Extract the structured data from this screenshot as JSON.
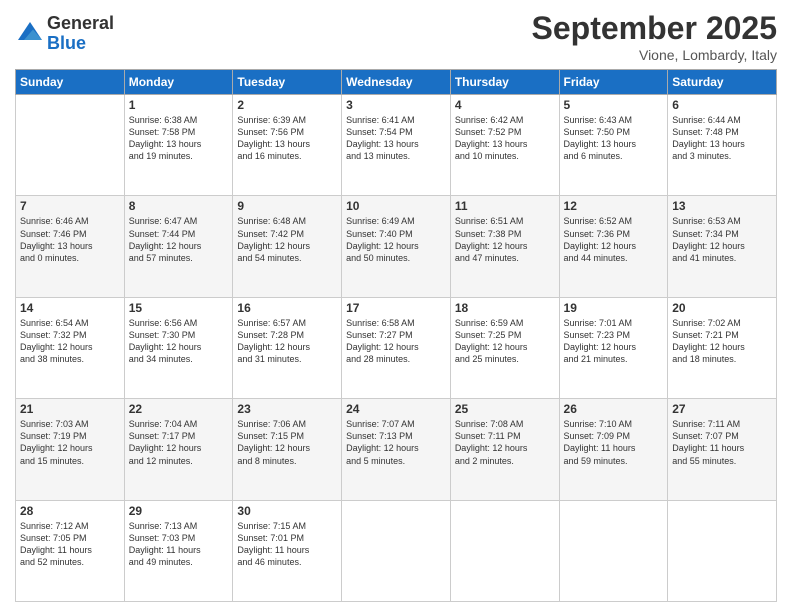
{
  "header": {
    "logo_general": "General",
    "logo_blue": "Blue",
    "month_title": "September 2025",
    "location": "Vione, Lombardy, Italy"
  },
  "days_of_week": [
    "Sunday",
    "Monday",
    "Tuesday",
    "Wednesday",
    "Thursday",
    "Friday",
    "Saturday"
  ],
  "weeks": [
    [
      {
        "day": "",
        "text": ""
      },
      {
        "day": "1",
        "text": "Sunrise: 6:38 AM\nSunset: 7:58 PM\nDaylight: 13 hours\nand 19 minutes."
      },
      {
        "day": "2",
        "text": "Sunrise: 6:39 AM\nSunset: 7:56 PM\nDaylight: 13 hours\nand 16 minutes."
      },
      {
        "day": "3",
        "text": "Sunrise: 6:41 AM\nSunset: 7:54 PM\nDaylight: 13 hours\nand 13 minutes."
      },
      {
        "day": "4",
        "text": "Sunrise: 6:42 AM\nSunset: 7:52 PM\nDaylight: 13 hours\nand 10 minutes."
      },
      {
        "day": "5",
        "text": "Sunrise: 6:43 AM\nSunset: 7:50 PM\nDaylight: 13 hours\nand 6 minutes."
      },
      {
        "day": "6",
        "text": "Sunrise: 6:44 AM\nSunset: 7:48 PM\nDaylight: 13 hours\nand 3 minutes."
      }
    ],
    [
      {
        "day": "7",
        "text": "Sunrise: 6:46 AM\nSunset: 7:46 PM\nDaylight: 13 hours\nand 0 minutes."
      },
      {
        "day": "8",
        "text": "Sunrise: 6:47 AM\nSunset: 7:44 PM\nDaylight: 12 hours\nand 57 minutes."
      },
      {
        "day": "9",
        "text": "Sunrise: 6:48 AM\nSunset: 7:42 PM\nDaylight: 12 hours\nand 54 minutes."
      },
      {
        "day": "10",
        "text": "Sunrise: 6:49 AM\nSunset: 7:40 PM\nDaylight: 12 hours\nand 50 minutes."
      },
      {
        "day": "11",
        "text": "Sunrise: 6:51 AM\nSunset: 7:38 PM\nDaylight: 12 hours\nand 47 minutes."
      },
      {
        "day": "12",
        "text": "Sunrise: 6:52 AM\nSunset: 7:36 PM\nDaylight: 12 hours\nand 44 minutes."
      },
      {
        "day": "13",
        "text": "Sunrise: 6:53 AM\nSunset: 7:34 PM\nDaylight: 12 hours\nand 41 minutes."
      }
    ],
    [
      {
        "day": "14",
        "text": "Sunrise: 6:54 AM\nSunset: 7:32 PM\nDaylight: 12 hours\nand 38 minutes."
      },
      {
        "day": "15",
        "text": "Sunrise: 6:56 AM\nSunset: 7:30 PM\nDaylight: 12 hours\nand 34 minutes."
      },
      {
        "day": "16",
        "text": "Sunrise: 6:57 AM\nSunset: 7:28 PM\nDaylight: 12 hours\nand 31 minutes."
      },
      {
        "day": "17",
        "text": "Sunrise: 6:58 AM\nSunset: 7:27 PM\nDaylight: 12 hours\nand 28 minutes."
      },
      {
        "day": "18",
        "text": "Sunrise: 6:59 AM\nSunset: 7:25 PM\nDaylight: 12 hours\nand 25 minutes."
      },
      {
        "day": "19",
        "text": "Sunrise: 7:01 AM\nSunset: 7:23 PM\nDaylight: 12 hours\nand 21 minutes."
      },
      {
        "day": "20",
        "text": "Sunrise: 7:02 AM\nSunset: 7:21 PM\nDaylight: 12 hours\nand 18 minutes."
      }
    ],
    [
      {
        "day": "21",
        "text": "Sunrise: 7:03 AM\nSunset: 7:19 PM\nDaylight: 12 hours\nand 15 minutes."
      },
      {
        "day": "22",
        "text": "Sunrise: 7:04 AM\nSunset: 7:17 PM\nDaylight: 12 hours\nand 12 minutes."
      },
      {
        "day": "23",
        "text": "Sunrise: 7:06 AM\nSunset: 7:15 PM\nDaylight: 12 hours\nand 8 minutes."
      },
      {
        "day": "24",
        "text": "Sunrise: 7:07 AM\nSunset: 7:13 PM\nDaylight: 12 hours\nand 5 minutes."
      },
      {
        "day": "25",
        "text": "Sunrise: 7:08 AM\nSunset: 7:11 PM\nDaylight: 12 hours\nand 2 minutes."
      },
      {
        "day": "26",
        "text": "Sunrise: 7:10 AM\nSunset: 7:09 PM\nDaylight: 11 hours\nand 59 minutes."
      },
      {
        "day": "27",
        "text": "Sunrise: 7:11 AM\nSunset: 7:07 PM\nDaylight: 11 hours\nand 55 minutes."
      }
    ],
    [
      {
        "day": "28",
        "text": "Sunrise: 7:12 AM\nSunset: 7:05 PM\nDaylight: 11 hours\nand 52 minutes."
      },
      {
        "day": "29",
        "text": "Sunrise: 7:13 AM\nSunset: 7:03 PM\nDaylight: 11 hours\nand 49 minutes."
      },
      {
        "day": "30",
        "text": "Sunrise: 7:15 AM\nSunset: 7:01 PM\nDaylight: 11 hours\nand 46 minutes."
      },
      {
        "day": "",
        "text": ""
      },
      {
        "day": "",
        "text": ""
      },
      {
        "day": "",
        "text": ""
      },
      {
        "day": "",
        "text": ""
      }
    ]
  ]
}
